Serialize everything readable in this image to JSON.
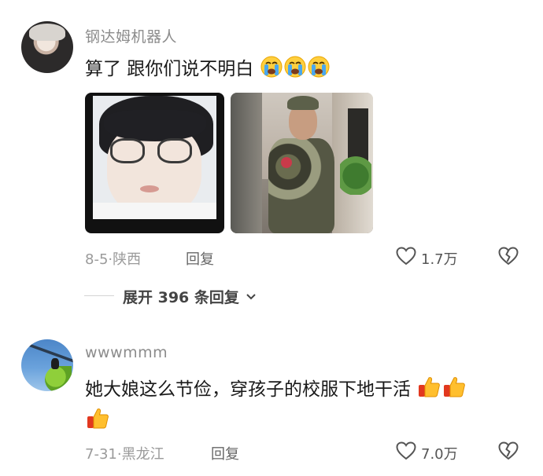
{
  "comments": [
    {
      "username": "钢达姆机器人",
      "text": "算了 跟你们说不明白",
      "emojis": [
        "crying-face",
        "crying-face",
        "crying-face"
      ],
      "images": [
        "selfie-glasses-photo",
        "street-camo-photo"
      ],
      "date": "8-5",
      "location": "陕西",
      "reply_label": "回复",
      "like_count": "1.7万",
      "expand_label": "展开 396 条回复"
    },
    {
      "username": "wwwmmm",
      "text": "她大娘这么节俭，穿孩子的校服下地干活",
      "emojis": [
        "thumbs-up",
        "thumbs-up",
        "thumbs-up"
      ],
      "date": "7-31",
      "location": "黑龙江",
      "reply_label": "回复",
      "like_count": "7.0万"
    }
  ],
  "colors": {
    "text": "#1a1a1a",
    "meta": "#9a9a9a",
    "username": "#8c8c8c",
    "icon": "#555555"
  }
}
